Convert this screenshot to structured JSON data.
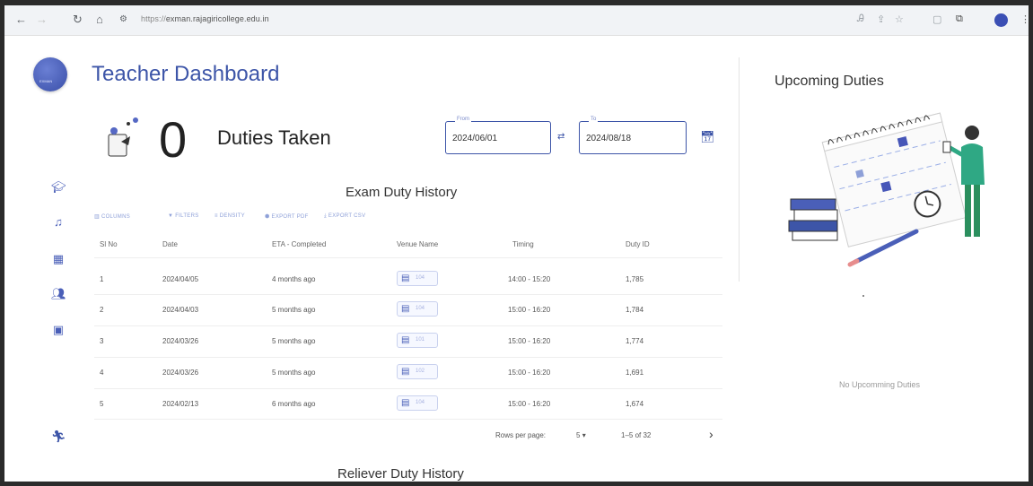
{
  "browser": {
    "url_proto": "https://",
    "url_host": "exman.rajagiricollege.edu.in",
    "icons": [
      "back-arrow-icon",
      "forward-arrow-icon",
      "reload-icon",
      "home-icon",
      "site-settings-icon",
      "translate-icon",
      "share-icon",
      "star-icon",
      "extension-icon",
      "puzzle-icon",
      "profile-avatar",
      "more-icon"
    ]
  },
  "sidebar": {
    "logo_text": "EXMAN",
    "items": [
      {
        "icon": "graduation-cap-icon"
      },
      {
        "icon": "bell-icon"
      },
      {
        "icon": "calendar-grid-icon"
      },
      {
        "icon": "users-icon"
      },
      {
        "icon": "video-icon"
      },
      {
        "icon": "running-person-icon"
      }
    ]
  },
  "header": {
    "title": "Teacher Dashboard"
  },
  "summary": {
    "count": "0",
    "label": "Duties Taken"
  },
  "date_filter": {
    "from_label": "From",
    "from_value": "2024/06/01",
    "to_label": "To",
    "to_value": "2024/08/18"
  },
  "exam_history": {
    "title": "Exam Duty History",
    "toolbar": {
      "columns": "COLUMNS",
      "filters": "FILTERS",
      "density": "DENSITY",
      "export_pdf": "EXPORT PDF",
      "export_csv": "EXPORT CSV"
    },
    "columns": [
      "Sl No",
      "Date",
      "ETA - Completed",
      "Venue Name",
      "Timing",
      "Duty ID"
    ],
    "rows": [
      {
        "sl": "1",
        "date": "2024/04/05",
        "eta": "4 months ago",
        "venue": "104",
        "timing": "14:00 - 15:20",
        "duty_id": "1,785"
      },
      {
        "sl": "2",
        "date": "2024/04/03",
        "eta": "5 months ago",
        "venue": "104",
        "timing": "15:00 - 16:20",
        "duty_id": "1,784"
      },
      {
        "sl": "3",
        "date": "2024/03/26",
        "eta": "5 months ago",
        "venue": "101",
        "timing": "15:00 - 16:20",
        "duty_id": "1,774"
      },
      {
        "sl": "4",
        "date": "2024/03/26",
        "eta": "5 months ago",
        "venue": "102",
        "timing": "15:00 - 16:20",
        "duty_id": "1,691"
      },
      {
        "sl": "5",
        "date": "2024/02/13",
        "eta": "6 months ago",
        "venue": "104",
        "timing": "15:00 - 16:20",
        "duty_id": "1,674"
      }
    ],
    "pagination": {
      "rows_per_page_label": "Rows per page:",
      "rows_per_page_value": "5",
      "range": "1–5 of 32"
    }
  },
  "reliever_history": {
    "title": "Reliever Duty History"
  },
  "upcoming": {
    "title": "Upcoming Duties",
    "empty_text": "No Upcomming Duties"
  },
  "colors": {
    "primary": "#3d55a8",
    "accent_light": "#8ea0d8"
  }
}
